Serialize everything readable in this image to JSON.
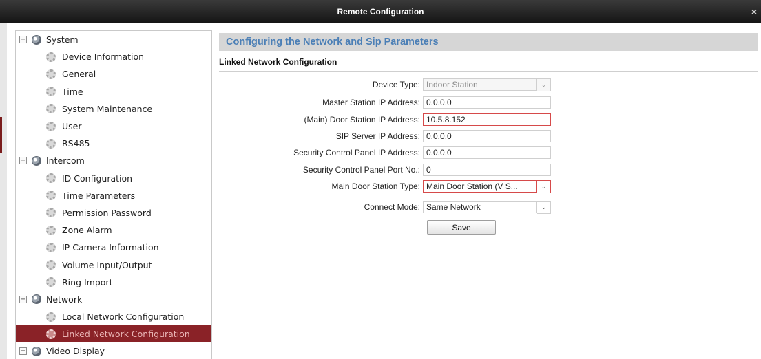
{
  "window": {
    "title": "Remote Configuration",
    "close_glyph": "×"
  },
  "sidebar": {
    "groups": [
      {
        "label": "System",
        "toggle": "−",
        "items": [
          "Device Information",
          "General",
          "Time",
          "System Maintenance",
          "User",
          "RS485"
        ]
      },
      {
        "label": "Intercom",
        "toggle": "−",
        "items": [
          "ID Configuration",
          "Time Parameters",
          "Permission Password",
          "Zone Alarm",
          "IP Camera Information",
          "Volume Input/Output",
          "Ring Import"
        ]
      },
      {
        "label": "Network",
        "toggle": "−",
        "items": [
          "Local Network Configuration",
          "Linked Network Configuration"
        ]
      },
      {
        "label": "Video Display",
        "toggle": "+",
        "items": []
      }
    ],
    "selected_item": "Linked Network Configuration",
    "selected_color": "#8a2227"
  },
  "main": {
    "header": "Configuring the Network and Sip Parameters",
    "section": "Linked Network Configuration",
    "form": {
      "device_type": {
        "label": "Device Type:",
        "value": "Indoor Station"
      },
      "master_ip": {
        "label": "Master Station IP Address:",
        "value": "0.0.0.0"
      },
      "door_ip": {
        "label": "(Main) Door Station IP Address:",
        "value": "10.5.8.152"
      },
      "sip_ip": {
        "label": "SIP Server IP Address:",
        "value": "0.0.0.0"
      },
      "panel_ip": {
        "label": "Security Control Panel IP Address:",
        "value": "0.0.0.0"
      },
      "panel_port": {
        "label": "Security Control Panel Port No.:",
        "value": "0"
      },
      "door_type": {
        "label": "Main Door Station Type:",
        "value": "Main Door Station (V S..."
      },
      "connect_mode": {
        "label": "Connect Mode:",
        "value": "Same Network"
      }
    },
    "save_label": "Save",
    "header_color": "#4b7fb6",
    "active_border_color": "#d64a4a"
  },
  "icons": {
    "group": "globe-icon",
    "item": "gear-icon",
    "dropdown": "chevron-down-icon",
    "close": "close-icon"
  }
}
